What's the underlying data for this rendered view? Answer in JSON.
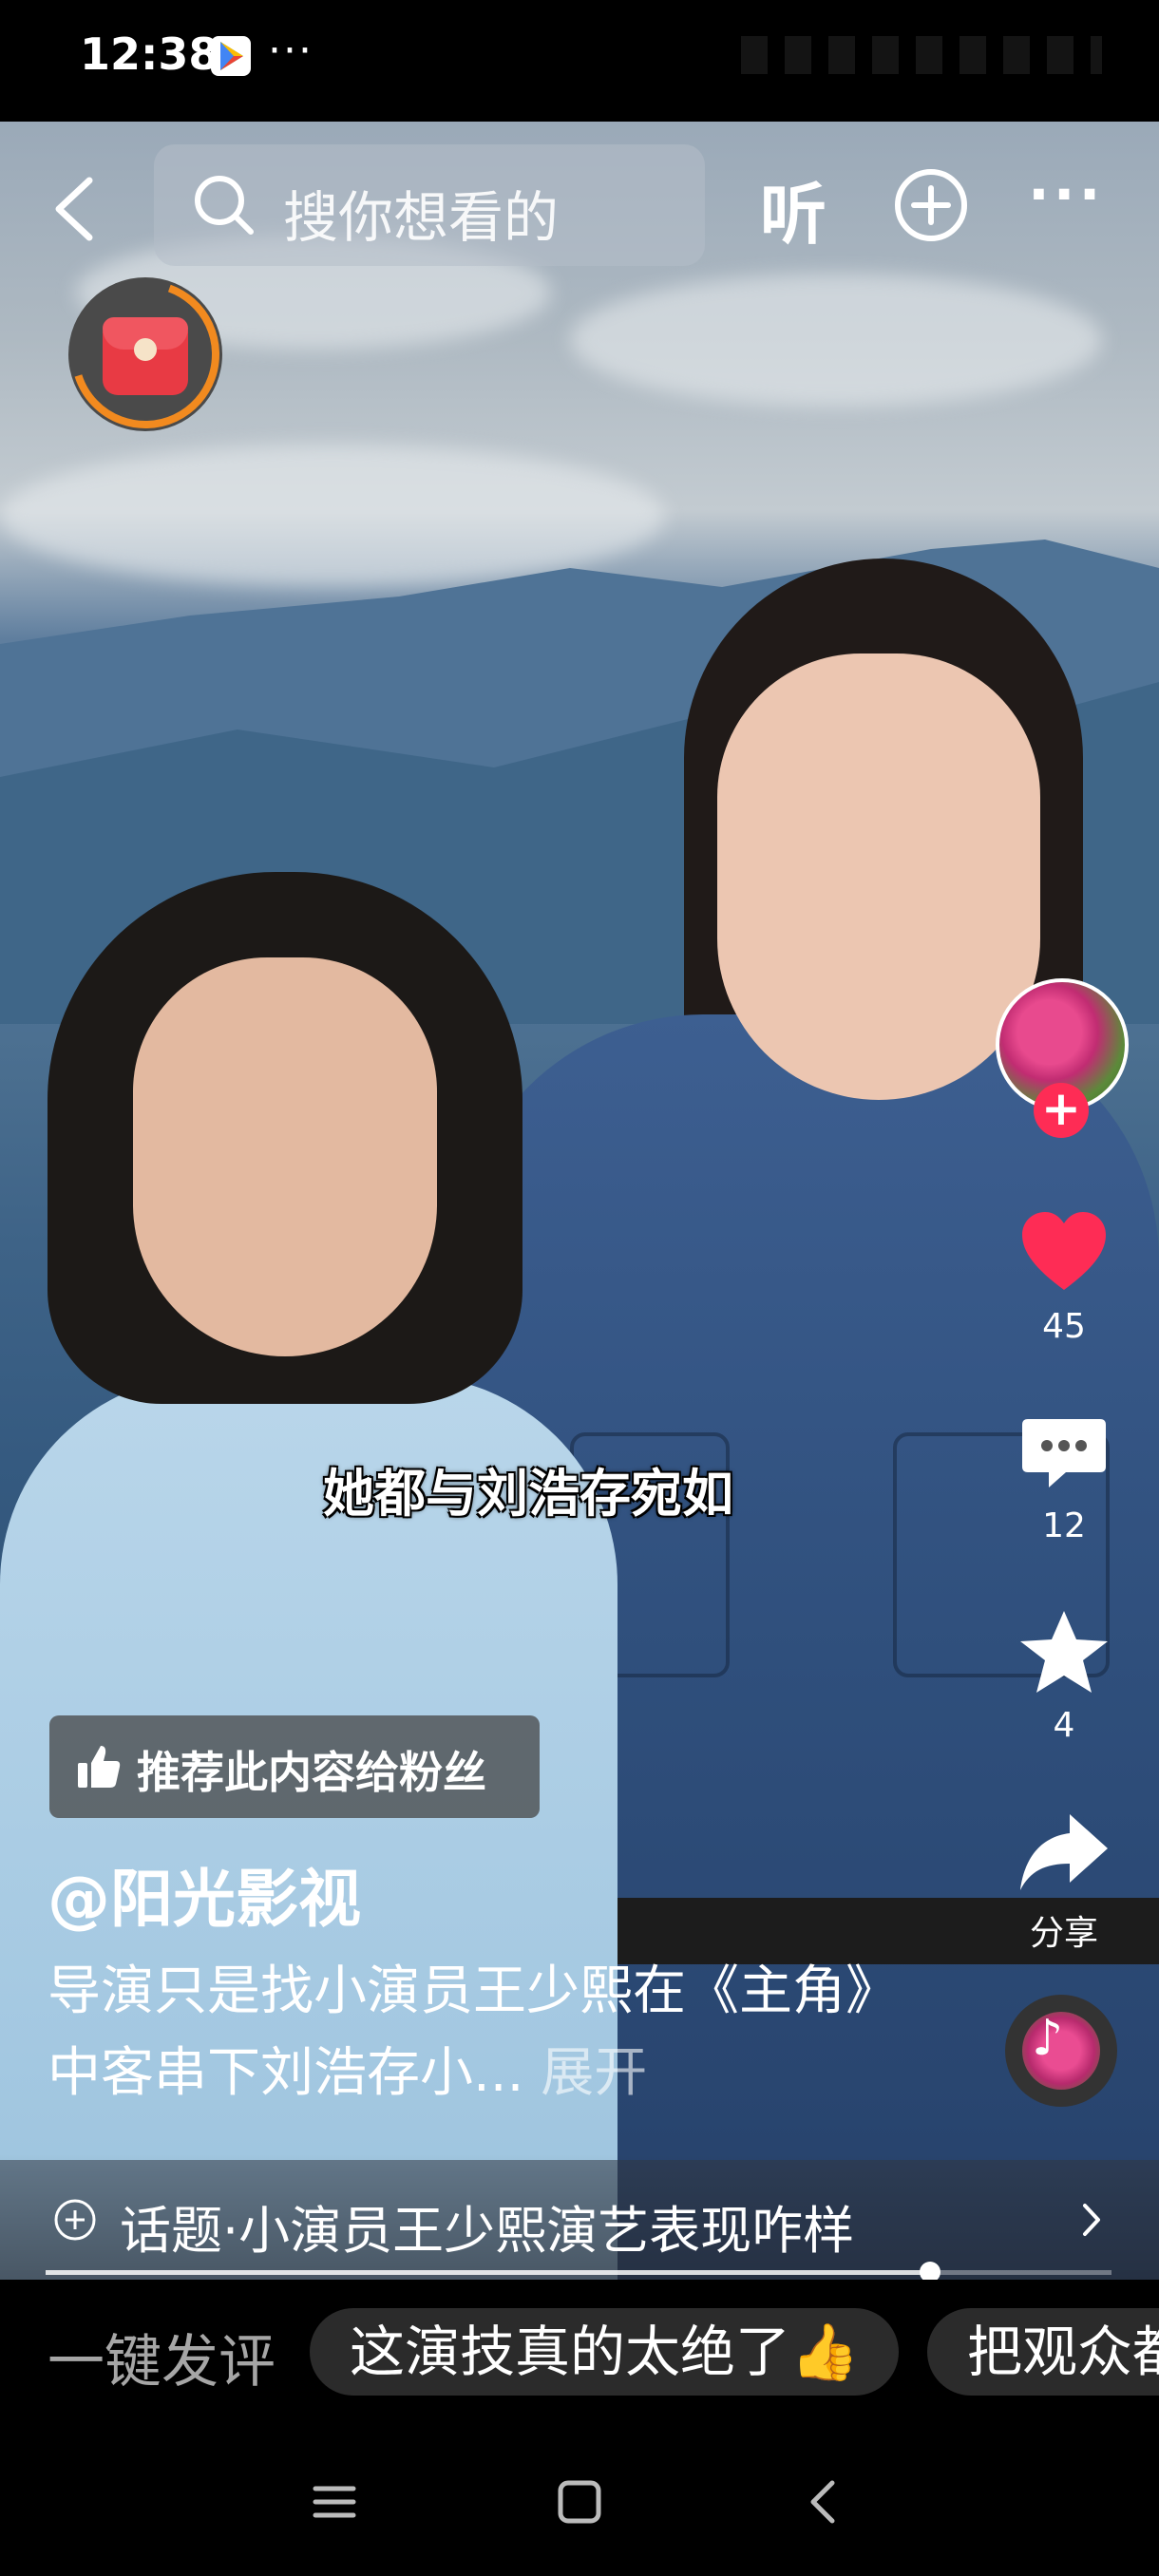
{
  "status_bar": {
    "time": "12:38",
    "more": "···"
  },
  "top_nav": {
    "search_placeholder": "搜你想看的",
    "listen_label": "听",
    "more_label": "···"
  },
  "video": {
    "subtitle": "她都与刘浩存宛如"
  },
  "side_actions": {
    "likes": "45",
    "comments": "12",
    "favorites": "4",
    "share_label": "分享"
  },
  "recommend": {
    "label": "推荐此内容给粉丝"
  },
  "author": {
    "name": "@阳光影视"
  },
  "description": {
    "text": "导演只是找小演员王少熙在《主角》中客串下刘浩存小...",
    "expand": "展开"
  },
  "topic": {
    "text": "话题·小演员王少熙演艺表现咋样"
  },
  "progress": {
    "fraction": 0.83
  },
  "comment_bar": {
    "prompt": "一键发评",
    "chips": [
      "这演技真的太绝了👍",
      "把观众都"
    ]
  },
  "colors": {
    "like": "#fe2c55",
    "follow": "#fe2c55",
    "ring": "#f28a1f"
  }
}
